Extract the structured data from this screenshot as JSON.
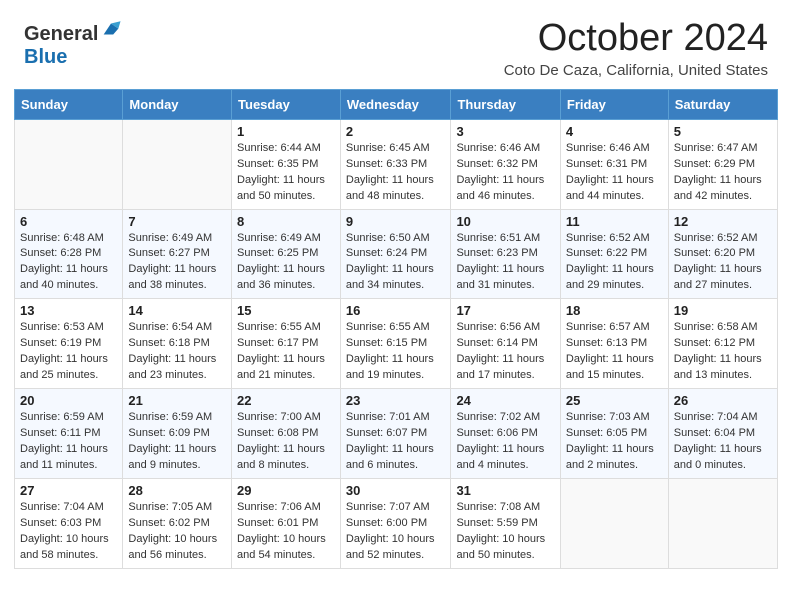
{
  "header": {
    "logo_general": "General",
    "logo_blue": "Blue",
    "month_title": "October 2024",
    "location": "Coto De Caza, California, United States"
  },
  "days_of_week": [
    "Sunday",
    "Monday",
    "Tuesday",
    "Wednesday",
    "Thursday",
    "Friday",
    "Saturday"
  ],
  "weeks": [
    [
      {
        "day": "",
        "empty": true
      },
      {
        "day": "",
        "empty": true
      },
      {
        "day": "1",
        "sunrise": "6:44 AM",
        "sunset": "6:35 PM",
        "daylight": "11 hours and 50 minutes."
      },
      {
        "day": "2",
        "sunrise": "6:45 AM",
        "sunset": "6:33 PM",
        "daylight": "11 hours and 48 minutes."
      },
      {
        "day": "3",
        "sunrise": "6:46 AM",
        "sunset": "6:32 PM",
        "daylight": "11 hours and 46 minutes."
      },
      {
        "day": "4",
        "sunrise": "6:46 AM",
        "sunset": "6:31 PM",
        "daylight": "11 hours and 44 minutes."
      },
      {
        "day": "5",
        "sunrise": "6:47 AM",
        "sunset": "6:29 PM",
        "daylight": "11 hours and 42 minutes."
      }
    ],
    [
      {
        "day": "6",
        "sunrise": "6:48 AM",
        "sunset": "6:28 PM",
        "daylight": "11 hours and 40 minutes."
      },
      {
        "day": "7",
        "sunrise": "6:49 AM",
        "sunset": "6:27 PM",
        "daylight": "11 hours and 38 minutes."
      },
      {
        "day": "8",
        "sunrise": "6:49 AM",
        "sunset": "6:25 PM",
        "daylight": "11 hours and 36 minutes."
      },
      {
        "day": "9",
        "sunrise": "6:50 AM",
        "sunset": "6:24 PM",
        "daylight": "11 hours and 34 minutes."
      },
      {
        "day": "10",
        "sunrise": "6:51 AM",
        "sunset": "6:23 PM",
        "daylight": "11 hours and 31 minutes."
      },
      {
        "day": "11",
        "sunrise": "6:52 AM",
        "sunset": "6:22 PM",
        "daylight": "11 hours and 29 minutes."
      },
      {
        "day": "12",
        "sunrise": "6:52 AM",
        "sunset": "6:20 PM",
        "daylight": "11 hours and 27 minutes."
      }
    ],
    [
      {
        "day": "13",
        "sunrise": "6:53 AM",
        "sunset": "6:19 PM",
        "daylight": "11 hours and 25 minutes."
      },
      {
        "day": "14",
        "sunrise": "6:54 AM",
        "sunset": "6:18 PM",
        "daylight": "11 hours and 23 minutes."
      },
      {
        "day": "15",
        "sunrise": "6:55 AM",
        "sunset": "6:17 PM",
        "daylight": "11 hours and 21 minutes."
      },
      {
        "day": "16",
        "sunrise": "6:55 AM",
        "sunset": "6:15 PM",
        "daylight": "11 hours and 19 minutes."
      },
      {
        "day": "17",
        "sunrise": "6:56 AM",
        "sunset": "6:14 PM",
        "daylight": "11 hours and 17 minutes."
      },
      {
        "day": "18",
        "sunrise": "6:57 AM",
        "sunset": "6:13 PM",
        "daylight": "11 hours and 15 minutes."
      },
      {
        "day": "19",
        "sunrise": "6:58 AM",
        "sunset": "6:12 PM",
        "daylight": "11 hours and 13 minutes."
      }
    ],
    [
      {
        "day": "20",
        "sunrise": "6:59 AM",
        "sunset": "6:11 PM",
        "daylight": "11 hours and 11 minutes."
      },
      {
        "day": "21",
        "sunrise": "6:59 AM",
        "sunset": "6:09 PM",
        "daylight": "11 hours and 9 minutes."
      },
      {
        "day": "22",
        "sunrise": "7:00 AM",
        "sunset": "6:08 PM",
        "daylight": "11 hours and 8 minutes."
      },
      {
        "day": "23",
        "sunrise": "7:01 AM",
        "sunset": "6:07 PM",
        "daylight": "11 hours and 6 minutes."
      },
      {
        "day": "24",
        "sunrise": "7:02 AM",
        "sunset": "6:06 PM",
        "daylight": "11 hours and 4 minutes."
      },
      {
        "day": "25",
        "sunrise": "7:03 AM",
        "sunset": "6:05 PM",
        "daylight": "11 hours and 2 minutes."
      },
      {
        "day": "26",
        "sunrise": "7:04 AM",
        "sunset": "6:04 PM",
        "daylight": "11 hours and 0 minutes."
      }
    ],
    [
      {
        "day": "27",
        "sunrise": "7:04 AM",
        "sunset": "6:03 PM",
        "daylight": "10 hours and 58 minutes."
      },
      {
        "day": "28",
        "sunrise": "7:05 AM",
        "sunset": "6:02 PM",
        "daylight": "10 hours and 56 minutes."
      },
      {
        "day": "29",
        "sunrise": "7:06 AM",
        "sunset": "6:01 PM",
        "daylight": "10 hours and 54 minutes."
      },
      {
        "day": "30",
        "sunrise": "7:07 AM",
        "sunset": "6:00 PM",
        "daylight": "10 hours and 52 minutes."
      },
      {
        "day": "31",
        "sunrise": "7:08 AM",
        "sunset": "5:59 PM",
        "daylight": "10 hours and 50 minutes."
      },
      {
        "day": "",
        "empty": true
      },
      {
        "day": "",
        "empty": true
      }
    ]
  ]
}
